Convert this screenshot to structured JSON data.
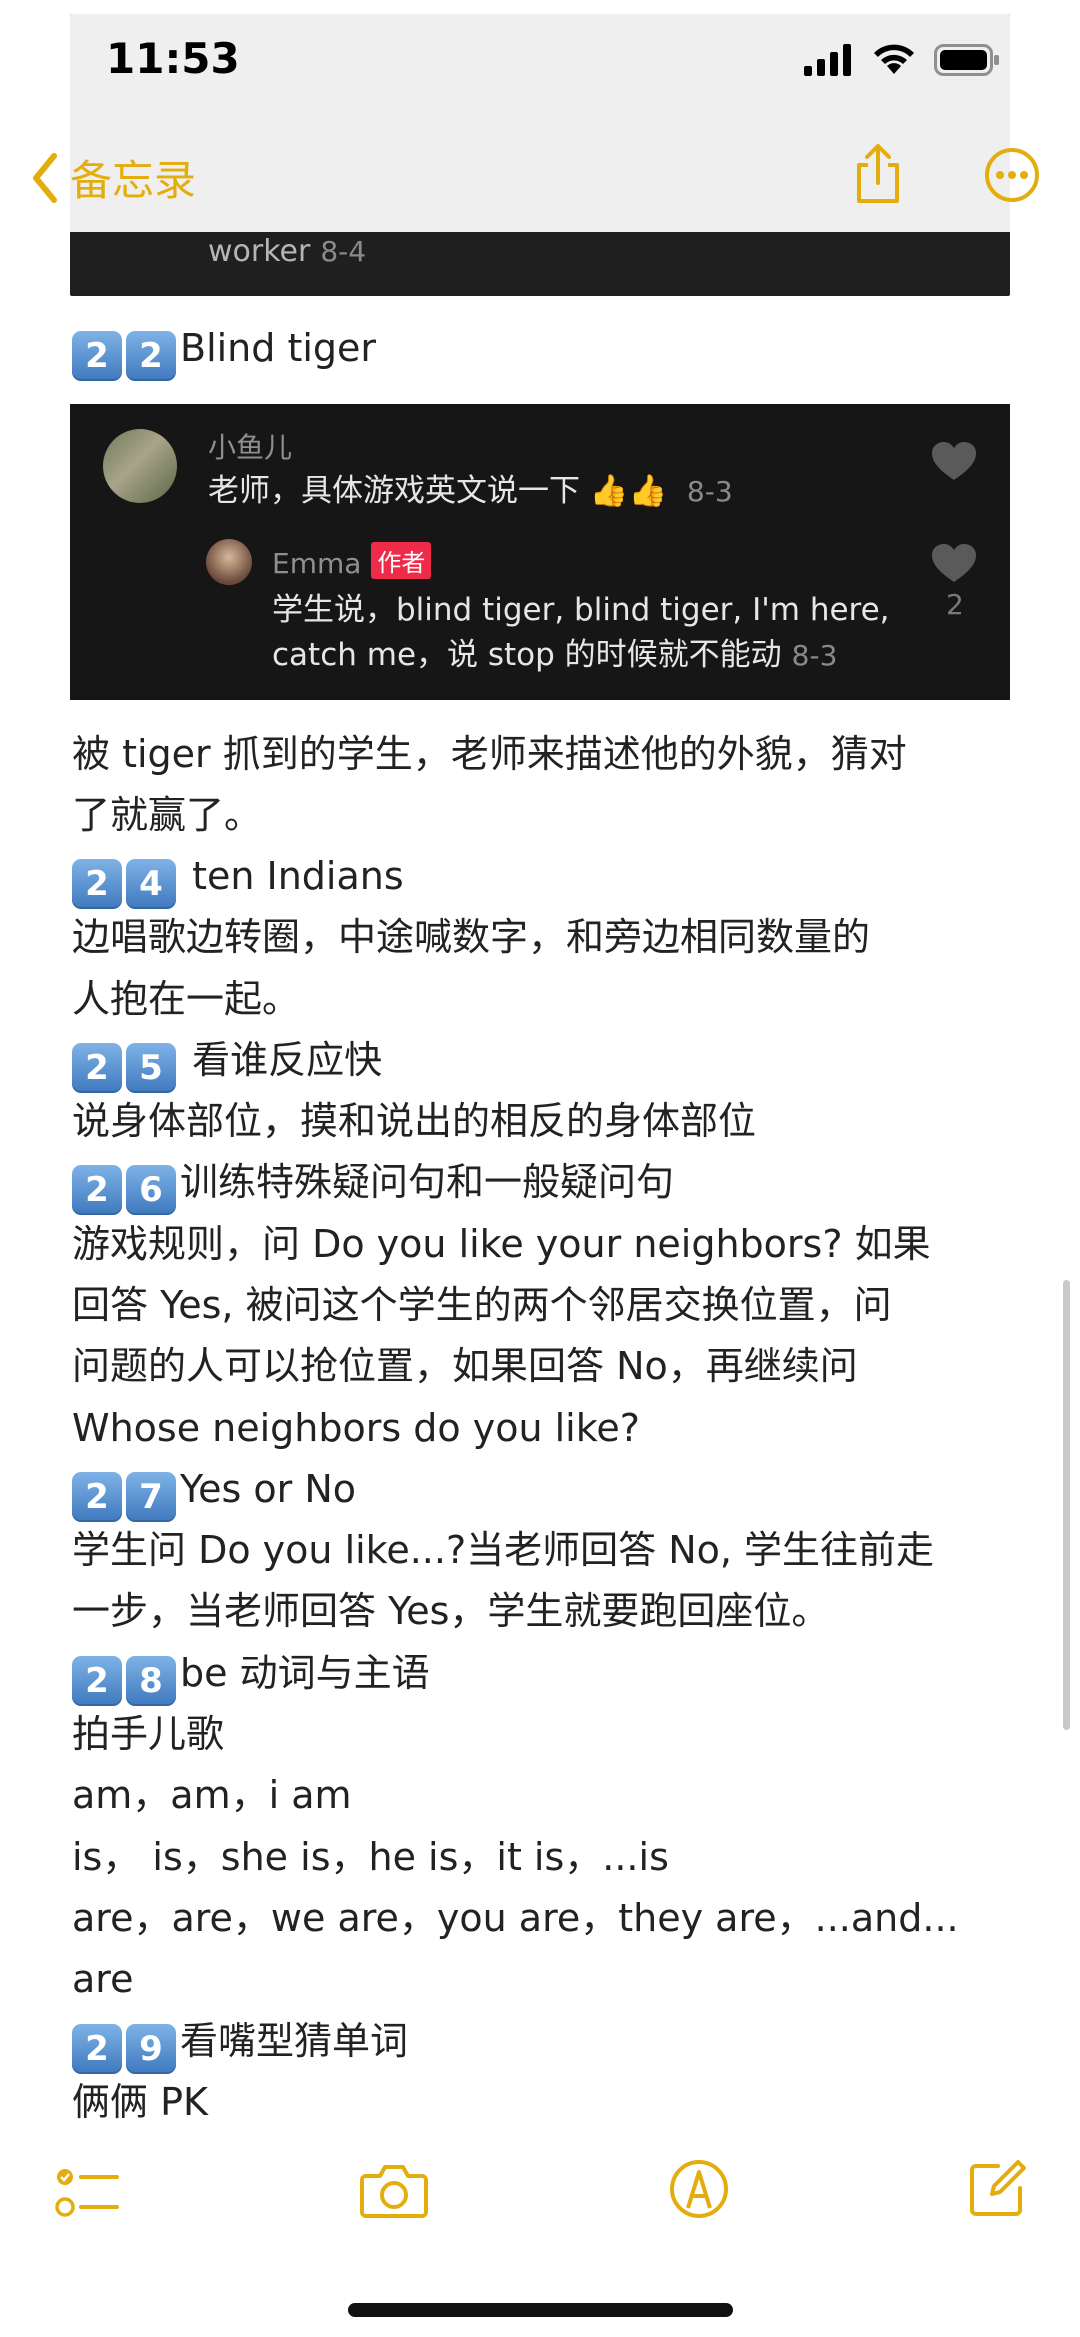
{
  "status": {
    "time": "11:53"
  },
  "nav": {
    "back_label": "备忘录"
  },
  "top_clip": {
    "text": "worker",
    "date": "8-4"
  },
  "heading_22": {
    "badges": [
      "2",
      "2"
    ],
    "text": "Blind tiger"
  },
  "comment": {
    "c1_name": "小鱼儿",
    "c1_text": "老师，具体游戏英文说一下",
    "c1_date": "8-3",
    "c2_name": "Emma",
    "c2_tag": "作者",
    "c2_line1": "学生说，blind tiger, blind tiger, I'm here,",
    "c2_line2": "catch me，说 stop 的时候就不能动",
    "c2_date": "8-3",
    "like_count": "2"
  },
  "body": {
    "p22_1": "被 tiger 抓到的学生，老师来描述他的外貌，猜对",
    "p22_2": "了就赢了。",
    "h24": {
      "badges": [
        "2",
        "4"
      ],
      "text": " ten Indians"
    },
    "p24_1": "边唱歌边转圈，中途喊数字，和旁边相同数量的",
    "p24_2": "人抱在一起。",
    "h25": {
      "badges": [
        "2",
        "5"
      ],
      "text": " 看谁反应快"
    },
    "p25_1": "说身体部位，摸和说出的相反的身体部位",
    "h26": {
      "badges": [
        "2",
        "6"
      ],
      "text": "训练特殊疑问句和一般疑问句"
    },
    "p26_1": "游戏规则，问 Do you like your neighbors? 如果",
    "p26_2": "回答 Yes, 被问这个学生的两个邻居交换位置，问",
    "p26_3": "问题的人可以抢位置，如果回答 No，再继续问",
    "p26_4": "Whose neighbors do you like?",
    "h27": {
      "badges": [
        "2",
        "7"
      ],
      "text": "Yes or No"
    },
    "p27_1": "学生问 Do you like...?当老师回答 No, 学生往前走",
    "p27_2": "一步，当老师回答 Yes，学生就要跑回座位。",
    "h28": {
      "badges": [
        "2",
        "8"
      ],
      "text": "be 动词与主语"
    },
    "p28_1": "拍手儿歌",
    "p28_2": "am，am，i am",
    "p28_3": "is， is，she is，he is，it is，...is",
    "p28_4": "are，are，we are，you are，they are，...and...",
    "p28_5": "are",
    "h29": {
      "badges": [
        "2",
        "9"
      ],
      "text": "看嘴型猜单词"
    },
    "p29_1": "俩俩 PK"
  },
  "colors": {
    "accent": "#e4ad0e",
    "badge": "#4a86c8",
    "comment_bg": "#161616",
    "author_tag": "#ef2b4a"
  },
  "icons": [
    "chevron-left-icon",
    "share-icon",
    "more-icon",
    "checklist-icon",
    "camera-icon",
    "markup-icon",
    "compose-icon",
    "heart-icon",
    "thumbs-up-icon",
    "signal-icon",
    "wifi-icon",
    "battery-icon"
  ]
}
